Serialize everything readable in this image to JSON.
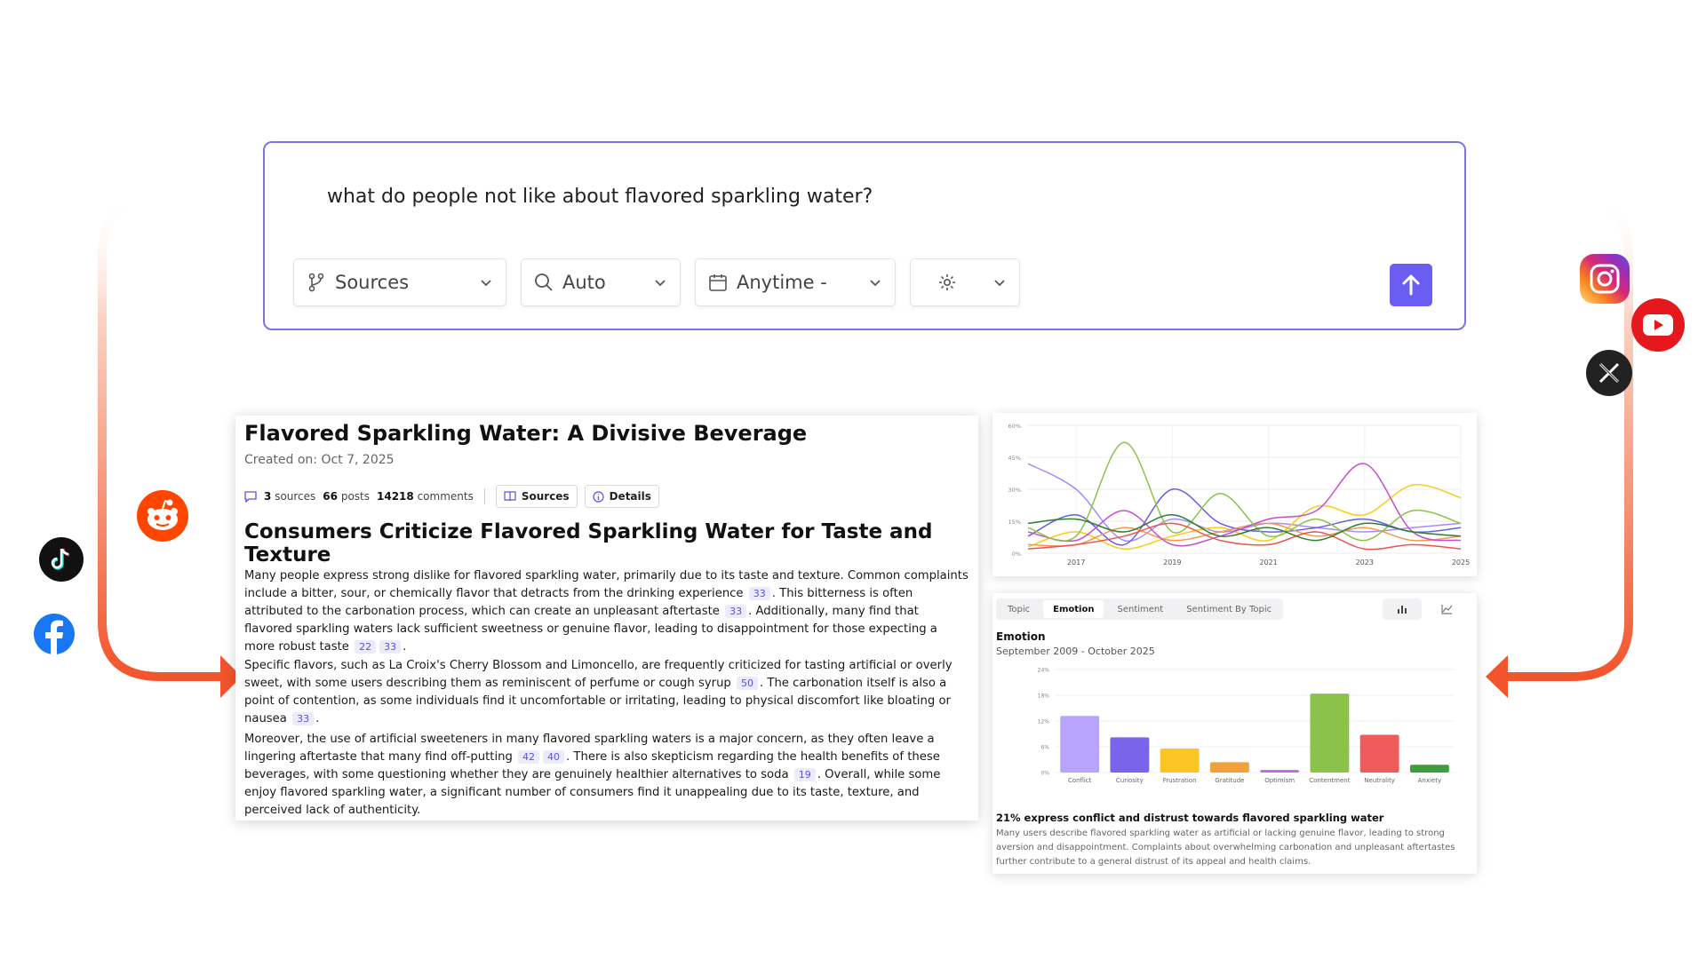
{
  "query": {
    "text": "what do people not like about flavored sparkling water?",
    "controls": {
      "sources": "Sources",
      "mode": "Auto",
      "time": "Anytime -"
    }
  },
  "social_icons": [
    "reddit-icon",
    "tiktok-icon",
    "facebook-icon",
    "instagram-icon",
    "youtube-icon",
    "x-icon"
  ],
  "colors": {
    "accent": "#6a5ef2",
    "arrow": "#f2552c"
  },
  "article": {
    "title": "Flavored Sparkling Water: A Divisive Beverage",
    "created": "Created on: Oct 7, 2025",
    "meta": {
      "sources_count": "3",
      "sources_word": "sources",
      "posts_count": "66",
      "posts_word": "posts",
      "comments_count": "14218",
      "comments_word": "comments",
      "sources_btn": "Sources",
      "details_btn": "Details"
    },
    "heading": "Consumers Criticize Flavored Sparkling Water for Taste and Texture",
    "p1": [
      "Many people express strong dislike for flavored sparkling water, primarily due to its taste and texture. Common complaints include a bitter, sour, or chemically flavor that detracts from the drinking experience",
      "33",
      ". This bitterness is often attributed to the carbonation process, which can create an unpleasant aftertaste",
      "33",
      ". Additionally, many find that flavored sparkling waters lack sufficient sweetness or genuine flavor, leading to disappointment for those expecting a more robust taste",
      "22",
      "33",
      "."
    ],
    "p2": [
      "Specific flavors, such as La Croix's Cherry Blossom and Limoncello, are frequently criticized for tasting artificial or overly sweet, with some users describing them as reminiscent of perfume or cough syrup",
      "50",
      ". The carbonation itself is also a point of contention, as some individuals find it uncomfortable or irritating, leading to physical discomfort like bloating or nausea",
      "33",
      "."
    ],
    "p3": [
      "Moreover, the use of artificial sweeteners in many flavored sparkling waters is a major concern, as they often leave a lingering aftertaste that many find off-putting",
      "42",
      "40",
      ". There is also skepticism regarding the health benefits of these beverages, with some questioning whether they are genuinely healthier alternatives to soda",
      "19",
      ". Overall, while some enjoy flavored sparkling water, a significant number of consumers find it unappealing due to its taste, texture, and perceived lack of authenticity."
    ]
  },
  "panel": {
    "tabs": [
      "Topic",
      "Emotion",
      "Sentiment",
      "Sentiment By Topic"
    ],
    "active_tab": "Emotion",
    "title": "Emotion",
    "date_range": "September 2009 - October 2025",
    "insight_head": "21% express conflict and distrust towards flavored sparkling water",
    "insight_body": "Many users describe flavored sparkling water as artificial or lacking genuine flavor, leading to strong aversion and disappointment. Complaints about overwhelming carbonation and unpleasant aftertastes further contribute to a general distrust of its appeal and health claims."
  },
  "chart_data": [
    {
      "type": "line",
      "x": [
        2016,
        2017,
        2018,
        2019,
        2020,
        2021,
        2022,
        2023,
        2024,
        2025
      ],
      "xticks": [
        "2017",
        "2019",
        "2021",
        "2023",
        "2025"
      ],
      "xtick_values": [
        2017,
        2019,
        2021,
        2023,
        2025
      ],
      "yticks": [
        "0%",
        "15%",
        "30%",
        "45%",
        "60%"
      ],
      "ylim": [
        0,
        60
      ],
      "grid": true,
      "series": [
        {
          "color": "#a78bfa",
          "values": [
            42,
            30,
            6,
            16,
            10,
            14,
            12,
            10,
            12,
            14
          ]
        },
        {
          "color": "#6b5ce7",
          "values": [
            8,
            18,
            4,
            30,
            14,
            10,
            12,
            16,
            10,
            12
          ]
        },
        {
          "color": "#facc15",
          "values": [
            3,
            10,
            2,
            8,
            12,
            6,
            22,
            18,
            32,
            26
          ]
        },
        {
          "color": "#f2994a",
          "values": [
            4,
            4,
            12,
            6,
            10,
            14,
            8,
            12,
            6,
            8
          ]
        },
        {
          "color": "#c44fd0",
          "values": [
            10,
            6,
            20,
            4,
            8,
            16,
            20,
            42,
            10,
            6
          ]
        },
        {
          "color": "#8bc34a",
          "values": [
            12,
            8,
            52,
            10,
            28,
            8,
            16,
            6,
            20,
            14
          ]
        },
        {
          "color": "#ef5350",
          "values": [
            2,
            4,
            8,
            14,
            6,
            4,
            10,
            2,
            4,
            2
          ]
        },
        {
          "color": "#2e7d32",
          "values": [
            14,
            16,
            10,
            18,
            8,
            12,
            6,
            14,
            10,
            8
          ]
        }
      ]
    },
    {
      "type": "bar",
      "categories": [
        "Conflict",
        "Curiosity",
        "Frustration",
        "Gratitude",
        "Optimism",
        "Contentment",
        "Neutrality",
        "Anxiety"
      ],
      "values": [
        13.2,
        8.2,
        5.6,
        2.4,
        0.6,
        18.4,
        8.8,
        1.8
      ],
      "colors": [
        "#b9a4fb",
        "#7b64ec",
        "#fbc524",
        "#f2a03c",
        "#c06ad8",
        "#8bc34a",
        "#ef5a5a",
        "#3f9e3c"
      ],
      "yticks": [
        "0%",
        "6%",
        "12%",
        "18%",
        "24%"
      ],
      "ylim": [
        0,
        24
      ],
      "grid": true
    }
  ]
}
